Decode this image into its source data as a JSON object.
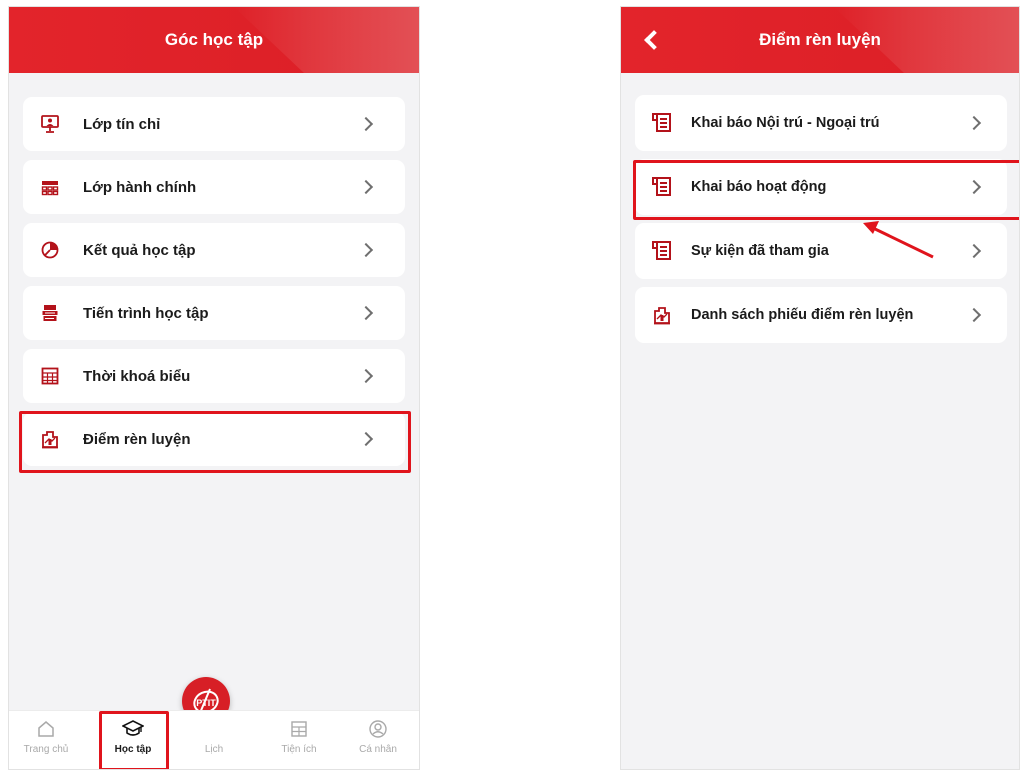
{
  "left_screen": {
    "title": "Góc học tập",
    "menu": [
      {
        "label": "Lớp tín chỉ",
        "icon": "presentation-board-icon"
      },
      {
        "label": "Lớp hành chính",
        "icon": "classroom-seats-icon"
      },
      {
        "label": "Kết quả học tập",
        "icon": "pie-chart-icon"
      },
      {
        "label": "Tiến trình học tập",
        "icon": "books-stack-icon"
      },
      {
        "label": "Thời khoá biểu",
        "icon": "calendar-grid-icon"
      },
      {
        "label": "Điểm rèn luyện",
        "icon": "score-chart-icon"
      }
    ],
    "bottom_nav": [
      {
        "label": "Trang chủ",
        "icon": "home-icon"
      },
      {
        "label": "Học tập",
        "icon": "graduation-cap-icon",
        "active": true
      },
      {
        "label": "Lịch",
        "icon": "ptit-logo-icon"
      },
      {
        "label": "Tiện ích",
        "icon": "utilities-icon"
      },
      {
        "label": "Cá nhân",
        "icon": "profile-icon"
      }
    ],
    "fab_logo_text": "PTIT"
  },
  "right_screen": {
    "title": "Điểm rèn luyện",
    "menu": [
      {
        "label": "Khai báo Nội trú - Ngoại trú",
        "icon": "document-scroll-icon"
      },
      {
        "label": "Khai báo hoạt động",
        "icon": "document-scroll-icon"
      },
      {
        "label": "Sự kiện đã tham gia",
        "icon": "document-scroll-icon"
      },
      {
        "label": "Danh sách phiếu điểm rèn luyện",
        "icon": "score-chart-icon"
      }
    ]
  },
  "colors": {
    "brand_red": "#e3242b",
    "highlight_red": "#e0141c",
    "icon_red": "#b3121a",
    "page_bg": "#f3f3f5"
  }
}
